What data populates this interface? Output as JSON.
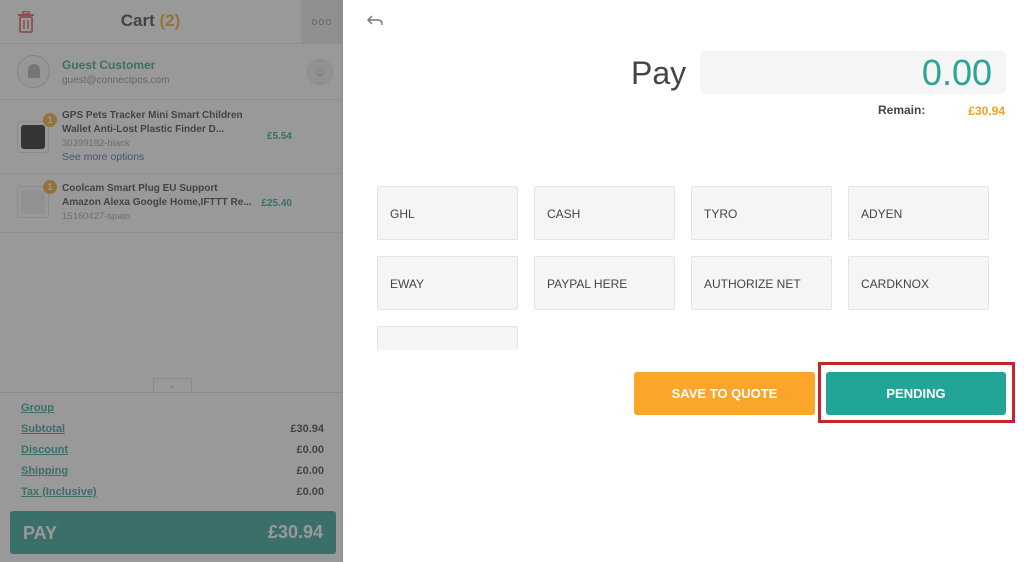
{
  "cart": {
    "title": "Cart",
    "count": "(2)",
    "more_label": "ooo",
    "customer": {
      "name": "Guest Customer",
      "email": "guest@connectpos.com"
    },
    "items": [
      {
        "qty": "1",
        "name": "GPS Pets Tracker Mini Smart Children Wallet Anti-Lost Plastic Finder D...",
        "sku": "30399182-black",
        "more_options": "See more options",
        "price": "£5.54"
      },
      {
        "qty": "1",
        "name": "Coolcam Smart Plug EU Support Amazon Alexa Google Home,IFTTT Re...",
        "sku": "15160427-spain",
        "price": "£25.40"
      }
    ],
    "summary": [
      {
        "label": "Group",
        "value": ""
      },
      {
        "label": "Subtotal",
        "value": "£30.94"
      },
      {
        "label": "Discount",
        "value": "£0.00"
      },
      {
        "label": "Shipping",
        "value": "£0.00"
      },
      {
        "label": "Tax (Inclusive)",
        "value": "£0.00"
      }
    ],
    "pay_button": {
      "label": "PAY",
      "amount": "£30.94"
    }
  },
  "payment": {
    "back_icon": "back-arrow-icon",
    "pay_label": "Pay",
    "amount_value": "0.00",
    "remain_label": "Remain:",
    "remain_value": "£30.94",
    "methods": [
      "GHL",
      "CASH",
      "TYRO",
      "ADYEN",
      "EWAY",
      "PAYPAL HERE",
      "AUTHORIZE NET",
      "CARDKNOX",
      ""
    ],
    "save_quote_label": "SAVE TO QUOTE",
    "pending_label": "PENDING"
  },
  "colors": {
    "teal": "#1f9b8e",
    "orange": "#f4a21c",
    "highlight": "#c1272d"
  }
}
